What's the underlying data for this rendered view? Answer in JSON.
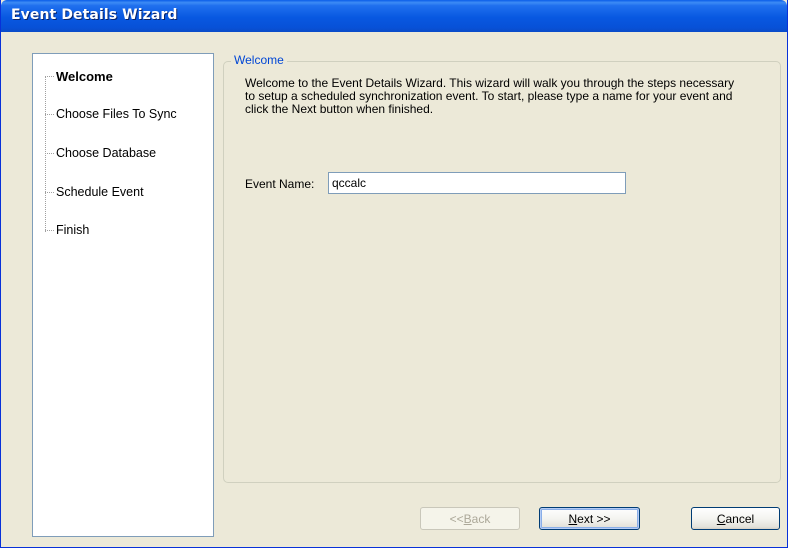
{
  "window": {
    "title": "Event Details Wizard"
  },
  "steps": [
    {
      "label": "Welcome",
      "active": true
    },
    {
      "label": "Choose Files To Sync",
      "active": false
    },
    {
      "label": "Choose Database",
      "active": false
    },
    {
      "label": "Schedule Event",
      "active": false
    },
    {
      "label": "Finish",
      "active": false
    }
  ],
  "page": {
    "group_title": "Welcome",
    "description": "Welcome to the Event Details Wizard. This wizard will walk you through the steps necessary to setup a scheduled synchronization event. To start, please type a name for your event and click the Next button when finished.",
    "event_name_label": "Event Name:",
    "event_name_value": "qccalc"
  },
  "buttons": {
    "back": {
      "prefix": "<< ",
      "mnemonic": "B",
      "rest": "ack",
      "enabled": false
    },
    "next": {
      "prefix": "",
      "mnemonic": "N",
      "rest": "ext >>",
      "enabled": true
    },
    "cancel": {
      "prefix": "",
      "mnemonic": "C",
      "rest": "ancel",
      "enabled": true
    }
  },
  "colors": {
    "titlebar": "#0858E1",
    "group_title": "#0046D5",
    "window_bg": "#ECE9D8"
  }
}
